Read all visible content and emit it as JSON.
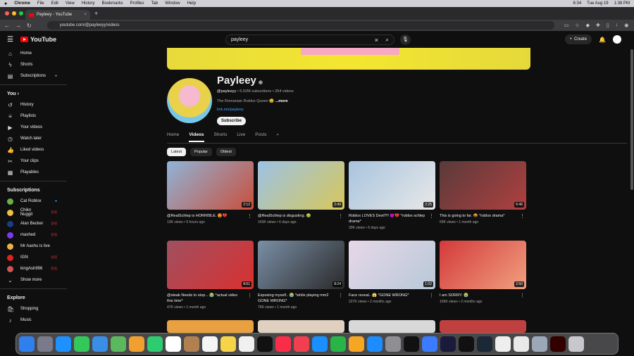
{
  "menubar": {
    "apple": "",
    "app": "Chrome",
    "items": [
      "File",
      "Edit",
      "View",
      "History",
      "Bookmarks",
      "Profiles",
      "Tab",
      "Window",
      "Help"
    ],
    "time": "6:34",
    "date": "Tue Aug 19",
    "clock": "1:38 PM"
  },
  "browser": {
    "tab_title": "Payleey - YouTube",
    "url": "youtube.com/@payleeyy/videos"
  },
  "header": {
    "brand": "YouTube",
    "search_value": "payleey",
    "create": "Create"
  },
  "sidebar": {
    "main": [
      {
        "label": "Home",
        "icon": "home-icon"
      },
      {
        "label": "Shorts",
        "icon": "shorts-icon"
      },
      {
        "label": "Subscriptions",
        "icon": "subscriptions-icon"
      }
    ],
    "you_title": "You",
    "you": [
      {
        "label": "History"
      },
      {
        "label": "Playlists"
      },
      {
        "label": "Your videos"
      },
      {
        "label": "Watch later"
      },
      {
        "label": "Liked videos"
      },
      {
        "label": "Your clips"
      },
      {
        "label": "Playables"
      }
    ],
    "subs_title": "Subscriptions",
    "subs": [
      {
        "label": "Cat Roblox",
        "color": "#6ab04c"
      },
      {
        "label": "Chikn Nuggit",
        "color": "#f0c040"
      },
      {
        "label": "Alan Becker",
        "color": "#1e3a8a"
      },
      {
        "label": "mashed",
        "color": "#7c3aed"
      },
      {
        "label": "Mr Aashu is live",
        "color": "#e8b04b"
      },
      {
        "label": "IGN",
        "color": "#d22"
      },
      {
        "label": "kingAsh996",
        "color": "#c55"
      }
    ],
    "show_more": "Show more",
    "explore_title": "Explore",
    "explore": [
      {
        "label": "Shopping"
      },
      {
        "label": "Music"
      }
    ]
  },
  "channel": {
    "name": "Payleey",
    "handle": "@payleeyy",
    "subs": "5.52M subscribers",
    "videos": "254 videos",
    "desc": "The Romanian Roblox Queen",
    "more": "...more",
    "link": "link.me/payleey",
    "subscribe": "Subscribe"
  },
  "tabs": [
    "Home",
    "Videos",
    "Shorts",
    "Live",
    "Posts"
  ],
  "chips": [
    "Latest",
    "Popular",
    "Oldest"
  ],
  "videos": [
    {
      "title": "@RealSchlep is HORRIBLE. 😍💔",
      "views": "13K views",
      "age": "5 hours ago",
      "dur": "2:12",
      "c1": "#8fb4d8",
      "c2": "#c94f3c"
    },
    {
      "title": "@RealSchlep is disgusting. 🤢",
      "views": "143K views",
      "age": "6 days ago",
      "dur": "2:49",
      "c1": "#9cc2e6",
      "c2": "#d7c85a"
    },
    {
      "title": "Roblox LOVES Devil?!! 😈💔 *roblox schlep drama*",
      "views": "30K views",
      "age": "6 days ago",
      "dur": "2:25",
      "c1": "#a8c4de",
      "c2": "#e8e8e8"
    },
    {
      "title": "This is going to far. 🤬 *roblox drama*",
      "views": "69K views",
      "age": "1 month ago",
      "dur": "6:46",
      "c1": "#5a3a3a",
      "c2": "#b04040"
    },
    {
      "title": "@steak Needs to stop... 😭 *actual video this time*",
      "views": "47K views",
      "age": "1 month ago",
      "dur": "8:51",
      "c1": "#a05060",
      "c2": "#d93030"
    },
    {
      "title": "Exposing myself.. 😭 *while playing mm2 GONE WRONG*",
      "views": "76K views",
      "age": "1 month ago",
      "dur": "8:24",
      "c1": "#7a8fa6",
      "c2": "#2a2a2a"
    },
    {
      "title": "Face reveal.. 😱 *GONE WRONG*",
      "views": "227K views",
      "age": "2 months ago",
      "dur": "1:02",
      "c1": "#e6d8e8",
      "c2": "#b8c8d8"
    },
    {
      "title": "I am SORRY. 😭",
      "views": "169K views",
      "age": "2 months ago",
      "dur": "2:50",
      "c1": "#d43a3a",
      "c2": "#f0a080"
    }
  ]
}
